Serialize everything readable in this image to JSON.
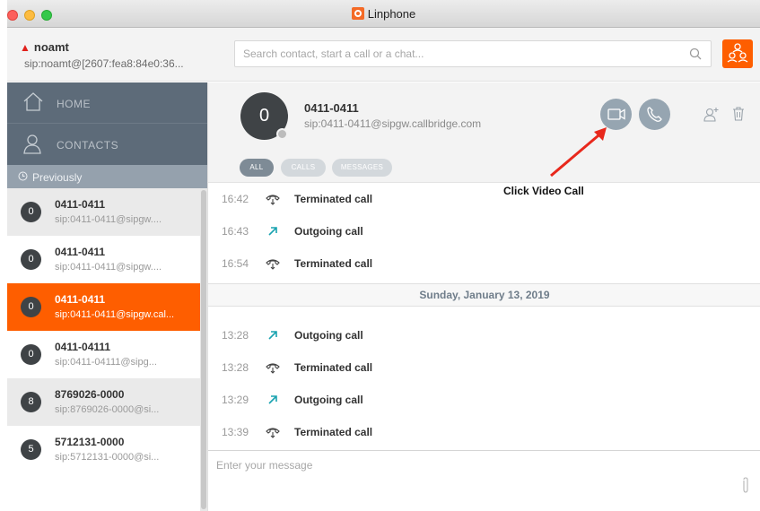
{
  "window": {
    "title": "Linphone"
  },
  "account": {
    "name": "noamt",
    "sip": "sip:noamt@[2607:fea8:84e0:36..."
  },
  "search": {
    "placeholder": "Search contact, start a call or a chat..."
  },
  "nav": {
    "home": "HOME",
    "contacts": "CONTACTS",
    "previously": "Previously"
  },
  "recent": [
    {
      "avatar": "0",
      "name": "0411-0411",
      "sip": "sip:0411-0411@sipgw....",
      "state": "alt"
    },
    {
      "avatar": "0",
      "name": "0411-0411",
      "sip": "sip:0411-0411@sipgw....",
      "state": "normal"
    },
    {
      "avatar": "0",
      "name": "0411-0411",
      "sip": "sip:0411-0411@sipgw.cal...",
      "state": "selected"
    },
    {
      "avatar": "0",
      "name": "0411-04111",
      "sip": "sip:0411-04111@sipg...",
      "state": "normal"
    },
    {
      "avatar": "8",
      "name": "8769026-0000",
      "sip": "sip:8769026-0000@si...",
      "state": "alt"
    },
    {
      "avatar": "5",
      "name": "5712131-0000",
      "sip": "sip:5712131-0000@si...",
      "state": "normal"
    }
  ],
  "contact": {
    "avatar": "0",
    "name": "0411-0411",
    "sip": "sip:0411-0411@sipgw.callbridge.com"
  },
  "filters": {
    "all": "ALL",
    "calls": "CALLS",
    "messages": "MESSAGES"
  },
  "events_day1": [
    {
      "time": "16:42",
      "type": "terminated",
      "text": "Terminated call"
    },
    {
      "time": "16:43",
      "type": "outgoing",
      "text": "Outgoing call"
    },
    {
      "time": "16:54",
      "type": "terminated",
      "text": "Terminated call"
    }
  ],
  "date_separator": "Sunday, January 13, 2019",
  "events_day2": [
    {
      "time": "13:28",
      "type": "outgoing",
      "text": "Outgoing call"
    },
    {
      "time": "13:28",
      "type": "terminated",
      "text": "Terminated call"
    },
    {
      "time": "13:29",
      "type": "outgoing",
      "text": "Outgoing call"
    },
    {
      "time": "13:39",
      "type": "terminated",
      "text": "Terminated call"
    }
  ],
  "composer": {
    "placeholder": "Enter your message"
  },
  "annotation": {
    "text": "Click Video Call",
    "color": "#e8281c"
  },
  "colors": {
    "accent": "#fe5e00",
    "nav_bg": "#5d6b79",
    "button": "#96a5b1",
    "outgoing": "#1aa3b0"
  }
}
